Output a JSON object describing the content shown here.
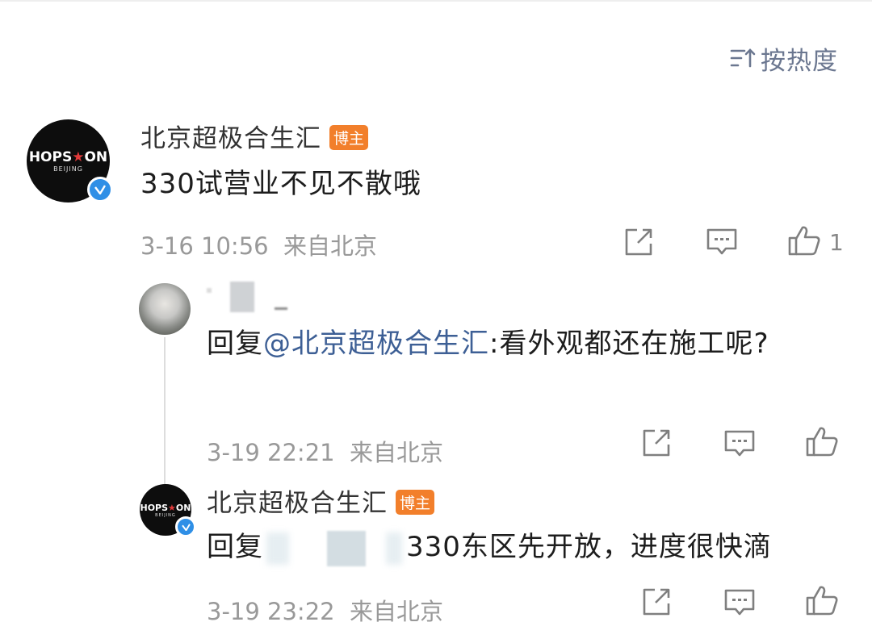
{
  "header": {
    "sort_label": "按热度"
  },
  "comment": {
    "author": "北京超极合生汇",
    "badge": "博主",
    "logo_text": "HOPS",
    "logo_star": "★",
    "logo_text2": "ON",
    "logo_city": "BEIJING",
    "text": "330试营业不见不散哦",
    "time": "3-16 10:56",
    "location": "来自北京",
    "likes": "1",
    "icons": [
      "share-icon",
      "comment-icon",
      "like-icon"
    ]
  },
  "replies": [
    {
      "reply_prefix": "回复",
      "mention": "@北京超极合生汇",
      "text": ":看外观都还在施工呢?",
      "time": "3-19 22:21",
      "location": "来自北京"
    },
    {
      "author": "北京超极合生汇",
      "badge": "博主",
      "reply_prefix": "回复",
      "text": "330东区先开放，进度很快滴",
      "time": "3-19 23:22",
      "location": "来自北京"
    }
  ],
  "colors": {
    "accent": "#3d5f95",
    "badge": "#f27f2b",
    "verified": "#2f8fe6"
  }
}
